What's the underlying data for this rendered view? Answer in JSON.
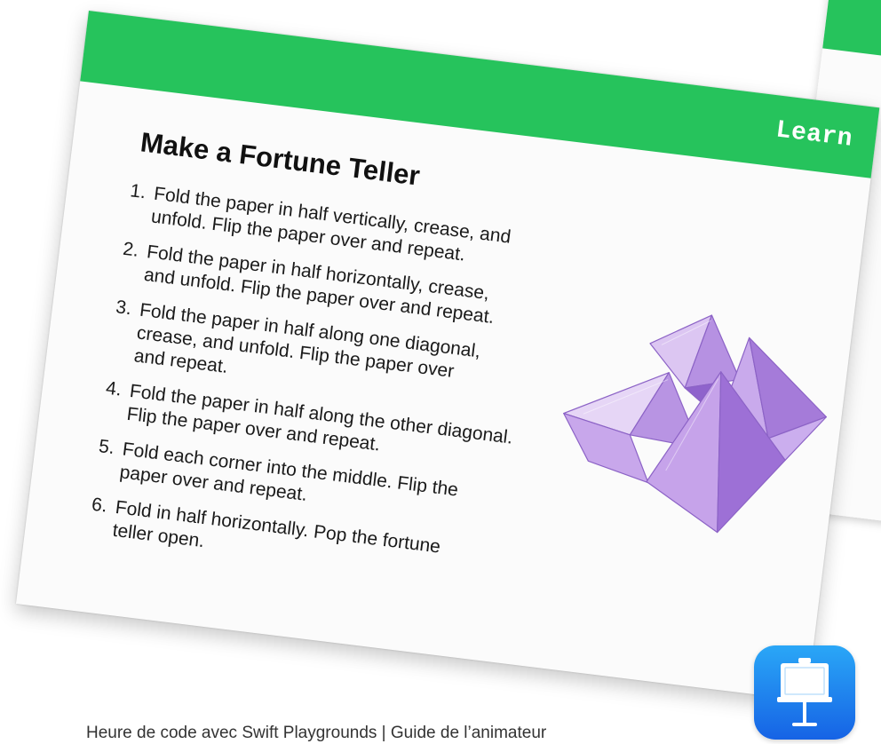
{
  "slide": {
    "header_label": "Learn",
    "title": "Make a Fortune Teller",
    "steps": [
      {
        "num": "1.",
        "lines": [
          "Fold the paper in half vertically, crease, and",
          "unfold. Flip the paper over and repeat."
        ]
      },
      {
        "num": "2.",
        "lines": [
          "Fold the paper in half horizontally, crease,",
          "and unfold. Flip the paper over and repeat."
        ]
      },
      {
        "num": "3.",
        "lines": [
          "Fold the paper in half along one diagonal,",
          "crease, and unfold. Flip the paper over",
          "and repeat."
        ]
      },
      {
        "num": "4.",
        "lines": [
          "Fold the paper in half along the other diagonal.",
          "Flip the paper over and repeat."
        ]
      },
      {
        "num": "5.",
        "lines": [
          "Fold each corner into the middle. Flip the",
          "paper over and repeat."
        ]
      },
      {
        "num": "6.",
        "lines": [
          "Fold in half horizontally. Pop the fortune",
          "teller open."
        ]
      }
    ],
    "illustration_icon": "fortune-teller-illustration"
  },
  "app_icon": "keynote-icon",
  "footer": {
    "text": "Heure de code avec Swift Playgrounds | Guide de l’animateur"
  },
  "colors": {
    "header_green": "#26c35c",
    "icon_blue_top": "#2aa7f7",
    "icon_blue_bottom": "#1663e5",
    "paper_purple": "#b48de2"
  }
}
